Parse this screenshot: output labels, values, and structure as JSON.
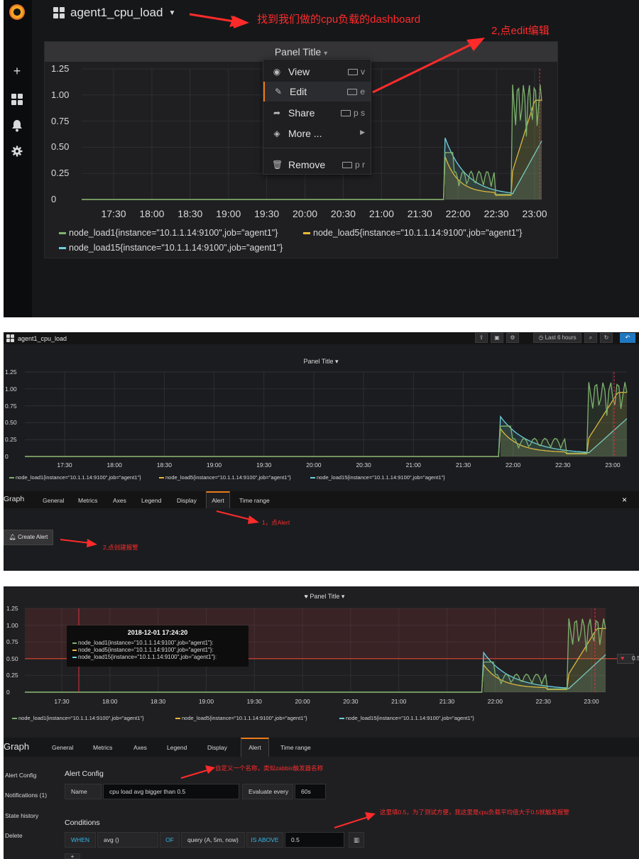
{
  "shot1": {
    "dashboard_title": "agent1_cpu_load",
    "panel_title": "Panel Title",
    "y_ticks": [
      "1.25",
      "1.00",
      "0.75",
      "0.50",
      "0.25",
      "0"
    ],
    "x_ticks": [
      "17:30",
      "18:00",
      "18:30",
      "19:00",
      "19:30",
      "20:00",
      "20:30",
      "21:00",
      "21:30",
      "22:00",
      "22:30",
      "23:00"
    ],
    "legend": [
      {
        "label": "node_load1{instance=\"10.1.1.14:9100\",job=\"agent1\"}",
        "color": "#7eb26d"
      },
      {
        "label": "node_load5{instance=\"10.1.1.14:9100\",job=\"agent1\"}",
        "color": "#eab839"
      },
      {
        "label": "node_load15{instance=\"10.1.1.14:9100\",job=\"agent1\"}",
        "color": "#6ed0e0"
      }
    ],
    "menu": [
      {
        "icon": "eye-icon",
        "label": "View",
        "shortcut": "v"
      },
      {
        "icon": "edit-icon",
        "label": "Edit",
        "shortcut": "e"
      },
      {
        "icon": "share-icon",
        "label": "Share",
        "shortcut": "p s"
      },
      {
        "icon": "cube-icon",
        "label": "More ...",
        "shortcut": ""
      },
      {
        "icon": "trash-icon",
        "label": "Remove",
        "shortcut": "p r"
      }
    ],
    "annotation_1": "找到我们做的cpu负载的dashboard",
    "annotation_2": "2,点edit编辑"
  },
  "shot2": {
    "dashboard_title": "agent1_cpu_load",
    "time_picker": "Last 6 hours",
    "panel_title": "Panel Title",
    "y_ticks": [
      "1.25",
      "1.00",
      "0.75",
      "0.50",
      "0.25",
      "0"
    ],
    "x_ticks": [
      "17:30",
      "18:00",
      "18:30",
      "19:00",
      "19:30",
      "20:00",
      "20:30",
      "21:00",
      "21:30",
      "22:00",
      "22:30",
      "23:00"
    ],
    "legend": [
      "node_load1{instance=\"10.1.1.14:9100\",job=\"agent1\"}",
      "node_load5{instance=\"10.1.1.14:9100\",job=\"agent1\"}",
      "node_load15{instance=\"10.1.1.14:9100\",job=\"agent1\"}"
    ],
    "editor_title": "Graph",
    "tabs": [
      "General",
      "Metrics",
      "Axes",
      "Legend",
      "Display",
      "Alert",
      "Time range"
    ],
    "close_symbol": "×",
    "create_alert_label": "Create Alert",
    "annotation_1": "1，点Alert",
    "annotation_2": "2,点创建报警"
  },
  "shot3": {
    "panel_title": "Panel Title",
    "y_ticks": [
      "1.25",
      "1.00",
      "0.75",
      "0.50",
      "0.25",
      "0"
    ],
    "x_ticks": [
      "17:30",
      "18:00",
      "18:30",
      "19:00",
      "19:30",
      "20:00",
      "20:30",
      "21:00",
      "21:30",
      "22:00",
      "22:30",
      "23:00"
    ],
    "threshold_value_label": "0.5",
    "tooltip": {
      "time": "2018-12-01 17:24:20",
      "rows": [
        "node_load1{instance=\"10.1.1.14:9100\",job=\"agent1\"}:",
        "node_load5{instance=\"10.1.1.14:9100\",job=\"agent1\"}:",
        "node_load15{instance=\"10.1.1.14:9100\",job=\"agent1\"}:"
      ]
    },
    "legend": [
      "node_load1{instance=\"10.1.1.14:9100\",job=\"agent1\"}",
      "node_load5{instance=\"10.1.1.14:9100\",job=\"agent1\"}",
      "node_load15{instance=\"10.1.1.14:9100\",job=\"agent1\"}"
    ],
    "editor_title": "Graph",
    "tabs": [
      "General",
      "Metrics",
      "Axes",
      "Legend",
      "Display",
      "Alert",
      "Time range"
    ],
    "side_nav": [
      "Alert Config",
      "Notifications (1)",
      "State history",
      "Delete"
    ],
    "alert_config_heading": "Alert Config",
    "name_label": "Name",
    "name_value": "cpu load avg  bigger than 0.5",
    "evaluate_label": "Evaluate every",
    "evaluate_value": "60s",
    "conditions_heading": "Conditions",
    "when_label": "WHEN",
    "reducer": "avg ()",
    "of_label": "OF",
    "query": "query (A, 5m, now)",
    "is_above_label": "IS ABOVE",
    "threshold_value": "0.5",
    "add_symbol": "+",
    "annotation_1": "自定义一个名称，类似zabbix触发器名称",
    "annotation_2": "这里填0.5，为了测试方便，我这里是cpu负载平均值大于0.5就触发报警"
  }
}
